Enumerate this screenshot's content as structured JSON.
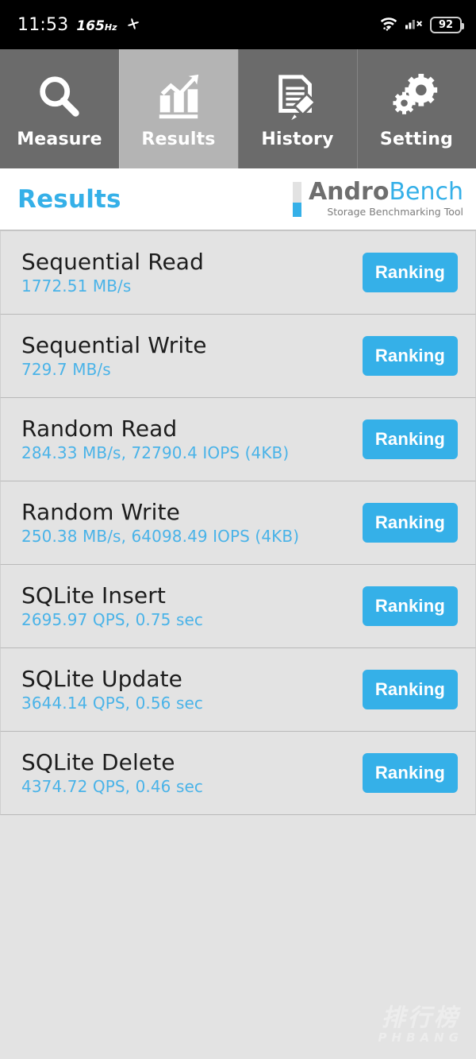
{
  "statusbar": {
    "time": "11:53",
    "refresh_rate": "165",
    "refresh_rate_unit": "Hz",
    "fan_icon": "fan-icon",
    "wifi_icon": "wifi-icon",
    "signal_icon": "cellular-signal-off-icon",
    "battery_level": "92"
  },
  "tabs": [
    {
      "label": "Measure",
      "icon": "magnifier-icon",
      "active": false
    },
    {
      "label": "Results",
      "icon": "bar-chart-arrow-icon",
      "active": true
    },
    {
      "label": "History",
      "icon": "document-pencil-icon",
      "active": false
    },
    {
      "label": "Setting",
      "icon": "gears-icon",
      "active": false
    }
  ],
  "header": {
    "title": "Results",
    "logo_andro": "Andro",
    "logo_bench": "Bench",
    "logo_subtitle": "Storage Benchmarking Tool"
  },
  "results": [
    {
      "title": "Sequential Read",
      "value": "1772.51 MB/s",
      "button": "Ranking"
    },
    {
      "title": "Sequential Write",
      "value": "729.7 MB/s",
      "button": "Ranking"
    },
    {
      "title": "Random Read",
      "value": "284.33 MB/s, 72790.4 IOPS (4KB)",
      "button": "Ranking"
    },
    {
      "title": "Random Write",
      "value": "250.38 MB/s, 64098.49 IOPS (4KB)",
      "button": "Ranking"
    },
    {
      "title": "SQLite Insert",
      "value": "2695.97 QPS, 0.75 sec",
      "button": "Ranking"
    },
    {
      "title": "SQLite Update",
      "value": "3644.14 QPS, 0.56 sec",
      "button": "Ranking"
    },
    {
      "title": "SQLite Delete",
      "value": "4374.72 QPS, 0.46 sec",
      "button": "Ranking"
    }
  ],
  "watermark": {
    "chinese": "排行榜",
    "latin": "PHBANG"
  },
  "colors": {
    "accent_blue": "#35b0e8",
    "value_blue": "#4ab3e8",
    "row_bg": "#e3e3e3",
    "tab_bg": "#6b6b6b",
    "tab_active_bg": "#b4b4b4",
    "statusbar_bg": "#000000"
  }
}
